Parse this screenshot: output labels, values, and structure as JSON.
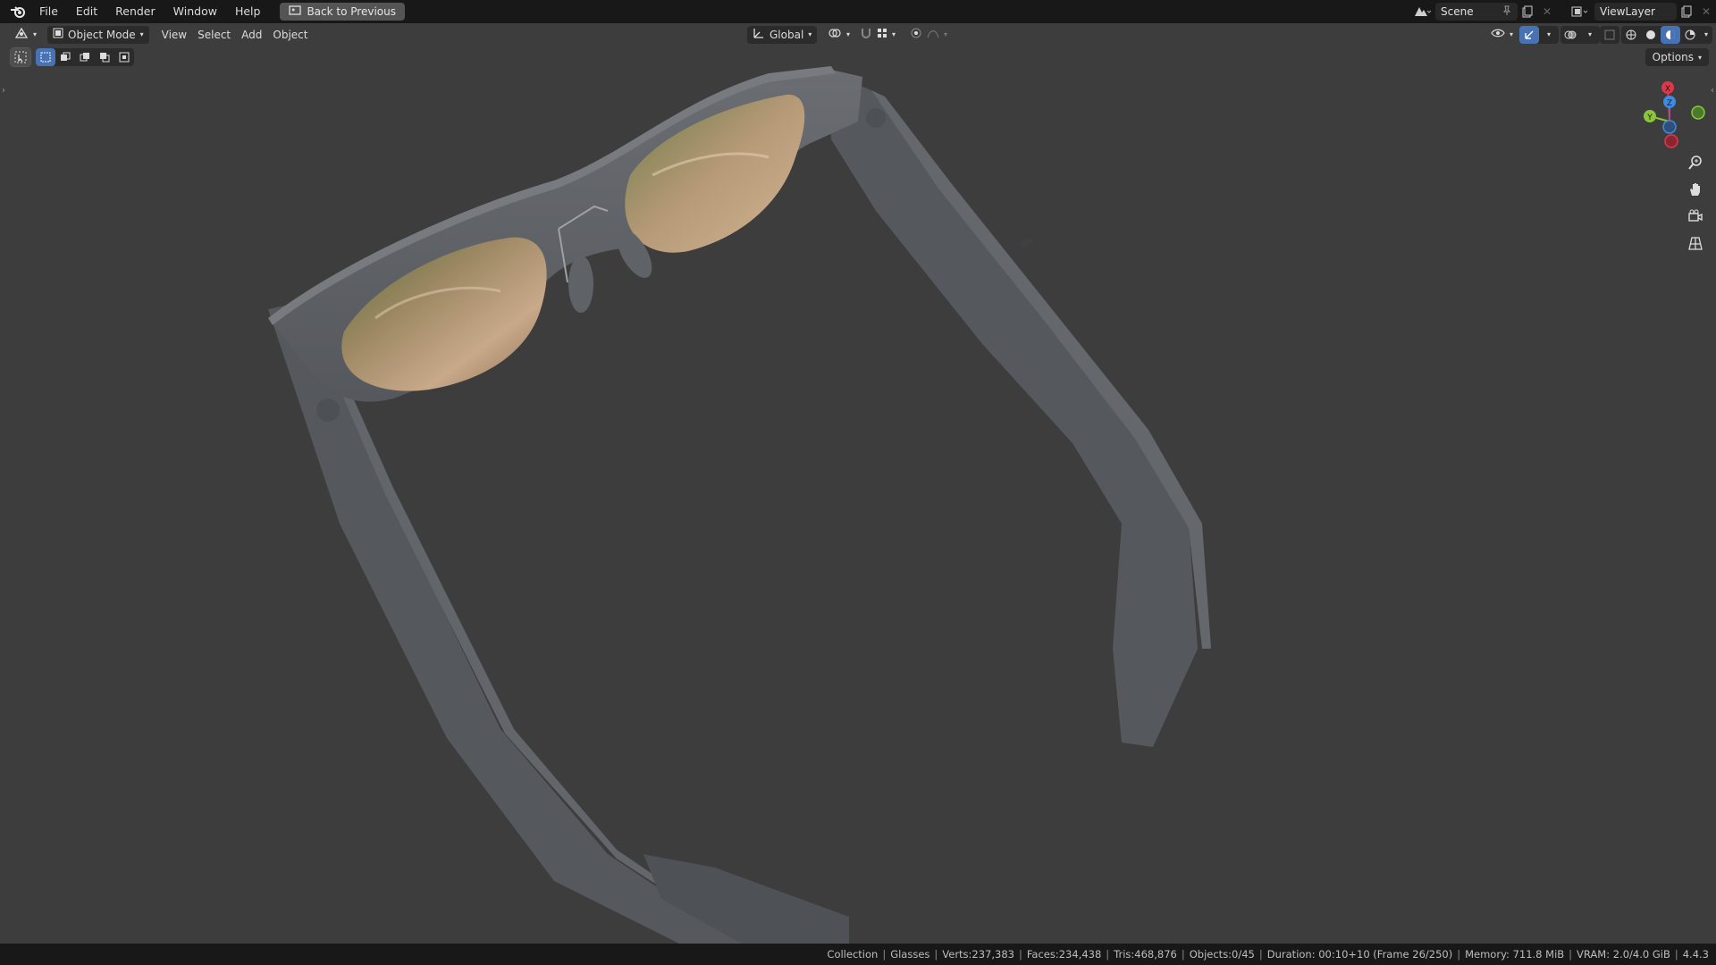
{
  "menu": {
    "items": [
      "File",
      "Edit",
      "Render",
      "Window",
      "Help"
    ],
    "back_button": "Back to Previous"
  },
  "top_right": {
    "scene_name": "Scene",
    "view_layer": "ViewLayer"
  },
  "viewport_header": {
    "mode": "Object Mode",
    "menus": [
      "View",
      "Select",
      "Add",
      "Object"
    ],
    "transform_orientation": "Global",
    "options_label": "Options"
  },
  "gizmo": {
    "x_label": "X",
    "y_label": "Y",
    "z_label": "Z"
  },
  "statusbar": {
    "items": [
      "Collection",
      "Glasses",
      "Verts:237,383",
      "Faces:234,438",
      "Tris:468,876",
      "Objects:0/45",
      "Duration: 00:10+10 (Frame 26/250)",
      "Memory: 711.8 MiB",
      "VRAM: 2.0/4.0 GiB",
      "4.4.3"
    ]
  },
  "colors": {
    "accent": "#4772b3",
    "axis_x": "#e0384b",
    "axis_y": "#8ac53b",
    "axis_z": "#3f8ae3"
  }
}
